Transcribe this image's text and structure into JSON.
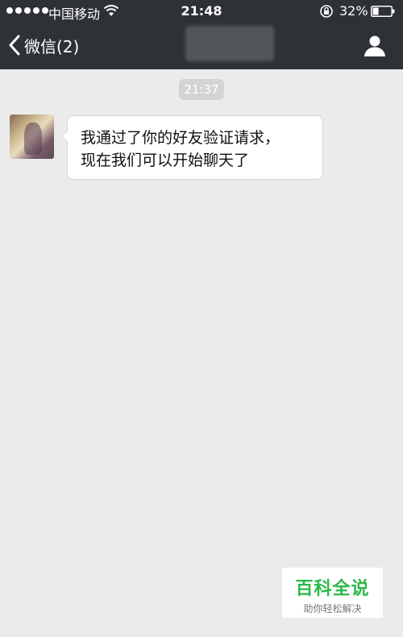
{
  "status_bar": {
    "carrier": "中国移动",
    "time": "21:48",
    "battery_percent": "32%",
    "battery_level": 0.32
  },
  "nav": {
    "back_label": "微信(2)",
    "title_redacted": true
  },
  "chat": {
    "timestamp": "21:37",
    "messages": [
      {
        "sender": "contact",
        "lines": [
          "我通过了你的好友验证请求，",
          "现在我们可以开始聊天了"
        ]
      }
    ]
  },
  "watermark": {
    "title": "百科全说",
    "subtitle": "助你轻松解决"
  },
  "colors": {
    "nav_bg": "#2e3135",
    "chat_bg": "#ebebeb",
    "bubble_bg": "#ffffff",
    "watermark_green": "#2db84a"
  }
}
